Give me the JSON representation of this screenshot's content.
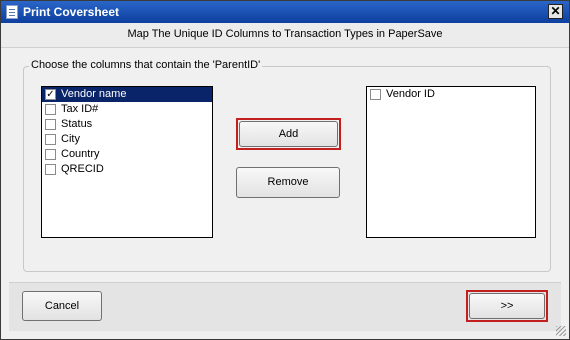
{
  "window": {
    "title": "Print Coversheet",
    "close_glyph": "✕"
  },
  "header": {
    "text": "Map The Unique ID Columns to Transaction Types in PaperSave"
  },
  "group": {
    "label": "Choose the columns that contain the 'ParentID'"
  },
  "left_list": {
    "items": [
      {
        "label": "Vendor name",
        "checked": true,
        "selected": true
      },
      {
        "label": "Tax ID#",
        "checked": false,
        "selected": false
      },
      {
        "label": "Status",
        "checked": false,
        "selected": false
      },
      {
        "label": "City",
        "checked": false,
        "selected": false
      },
      {
        "label": "Country",
        "checked": false,
        "selected": false
      },
      {
        "label": "QRECID",
        "checked": false,
        "selected": false
      }
    ]
  },
  "right_list": {
    "items": [
      {
        "label": "Vendor ID",
        "checked": false
      }
    ]
  },
  "buttons": {
    "add": "Add",
    "remove": "Remove",
    "cancel": "Cancel",
    "next": ">>"
  },
  "colors": {
    "highlight_outline": "#c21f1f",
    "selection": "#0a246a",
    "titlebar": "#1c52b8"
  }
}
